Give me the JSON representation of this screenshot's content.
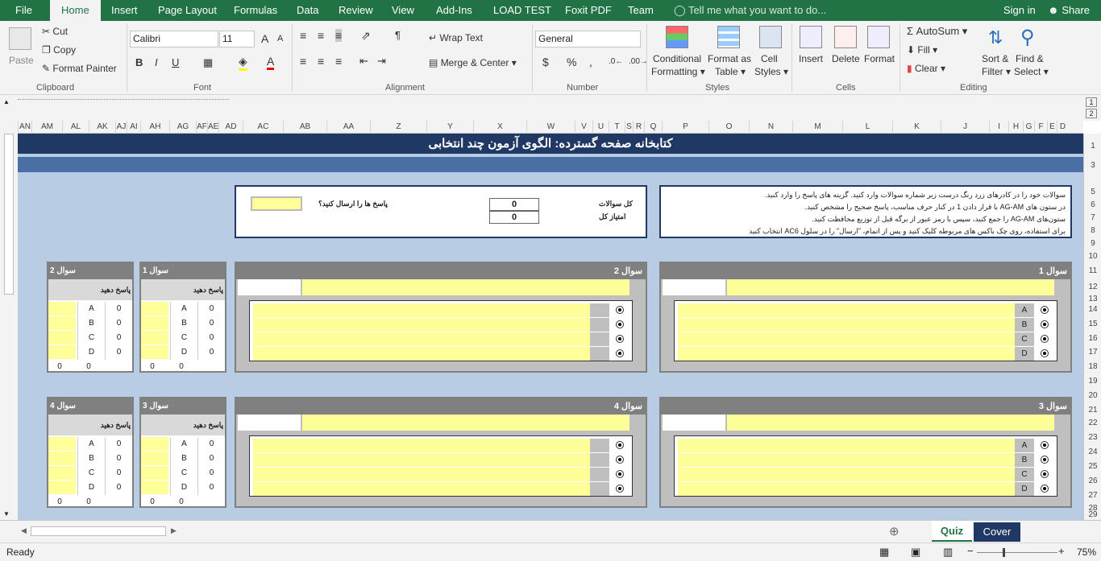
{
  "tabs": [
    "File",
    "Home",
    "Insert",
    "Page Layout",
    "Formulas",
    "Data",
    "Review",
    "View",
    "Add-Ins",
    "LOAD TEST",
    "Foxit PDF",
    "Team"
  ],
  "tell_me": "Tell me what you want to do...",
  "sign_in": "Sign in",
  "share": "Share",
  "clipboard": {
    "paste": "Paste",
    "cut": "Cut",
    "copy": "Copy",
    "format_painter": "Format Painter",
    "label": "Clipboard"
  },
  "font": {
    "name": "Calibri",
    "size": "11",
    "label": "Font",
    "bold": "B",
    "italic": "I",
    "underline": "U"
  },
  "alignment": {
    "wrap": "Wrap Text",
    "merge": "Merge & Center",
    "label": "Alignment"
  },
  "number": {
    "format": "General",
    "label": "Number",
    "currency": "$",
    "percent": "%",
    "comma": ","
  },
  "styles": {
    "conditional": "Conditional",
    "conditional2": "Formatting",
    "format_table": "Format as",
    "format_table2": "Table",
    "cell_styles": "Cell",
    "cell_styles2": "Styles",
    "label": "Styles"
  },
  "cells": {
    "insert": "Insert",
    "delete": "Delete",
    "format": "Format",
    "label": "Cells"
  },
  "editing": {
    "autosum": "AutoSum",
    "fill": "Fill",
    "clear": "Clear",
    "sort": "Sort &",
    "sort2": "Filter",
    "find": "Find &",
    "find2": "Select",
    "label": "Editing"
  },
  "columns": [
    "AN",
    "AM",
    "AL",
    "AK",
    "AJ",
    "AI",
    "AH",
    "AG",
    "AF",
    "AE",
    "AD",
    "AC",
    "AB",
    "AA",
    "Z",
    "Y",
    "X",
    "W",
    "V",
    "U",
    "T",
    "S",
    "R",
    "Q",
    "P",
    "O",
    "N",
    "M",
    "L",
    "K",
    "J",
    "I",
    "H",
    "G",
    "F",
    "E",
    "D"
  ],
  "rows": [
    "1",
    "3",
    "5",
    "6",
    "7",
    "8",
    "9",
    "10",
    "11",
    "12",
    "13",
    "14",
    "15",
    "16",
    "17",
    "18",
    "19",
    "20",
    "21",
    "22",
    "23",
    "24",
    "25",
    "26",
    "27",
    "28",
    "29"
  ],
  "sheet": {
    "title": "کتابخانه صفحه گسترده: الگوی آزمون چند انتخابی",
    "instructions": [
      "سوالات خود را در کادرهای زرد رنگ درست زیر شماره سوالات وارد کنید. گزینه های پاسخ را وارد کنید.",
      "در ستون های AG-AM با قرار دادن 1 در کنار حرف مناسب، پاسخ صحیح را مشخص کنید.",
      "ستون‌های AG-AM را جمع کنید، سپس با رمز عبور از برگه قبل از توزیع محافظت کنید.",
      "برای استفاده، روی چک باکس های مربوطه کلیک کنید و پس از اتمام، \"ارسال\" را در سلول AC6 انتخاب کنید"
    ],
    "total_questions_label": "کل سوالات",
    "total_score_label": "امتیاز کل",
    "total_questions": "0",
    "total_score": "0",
    "submit_label": "پاسخ ها را ارسال کنید؟",
    "questions": [
      "سوال 1",
      "سوال 2",
      "سوال 3",
      "سوال 4"
    ],
    "answer_label": "پاسخ دهید",
    "letters": [
      "A",
      "B",
      "C",
      "D"
    ],
    "zero": "0"
  },
  "sheet_tabs": [
    "Quiz",
    "Cover"
  ],
  "status": {
    "ready": "Ready",
    "zoom": "75%"
  },
  "colors": {
    "excel_green": "#217346",
    "title_navy": "#1f3864",
    "grid_bg": "#b8cce4",
    "yellow": "#ffff99"
  }
}
